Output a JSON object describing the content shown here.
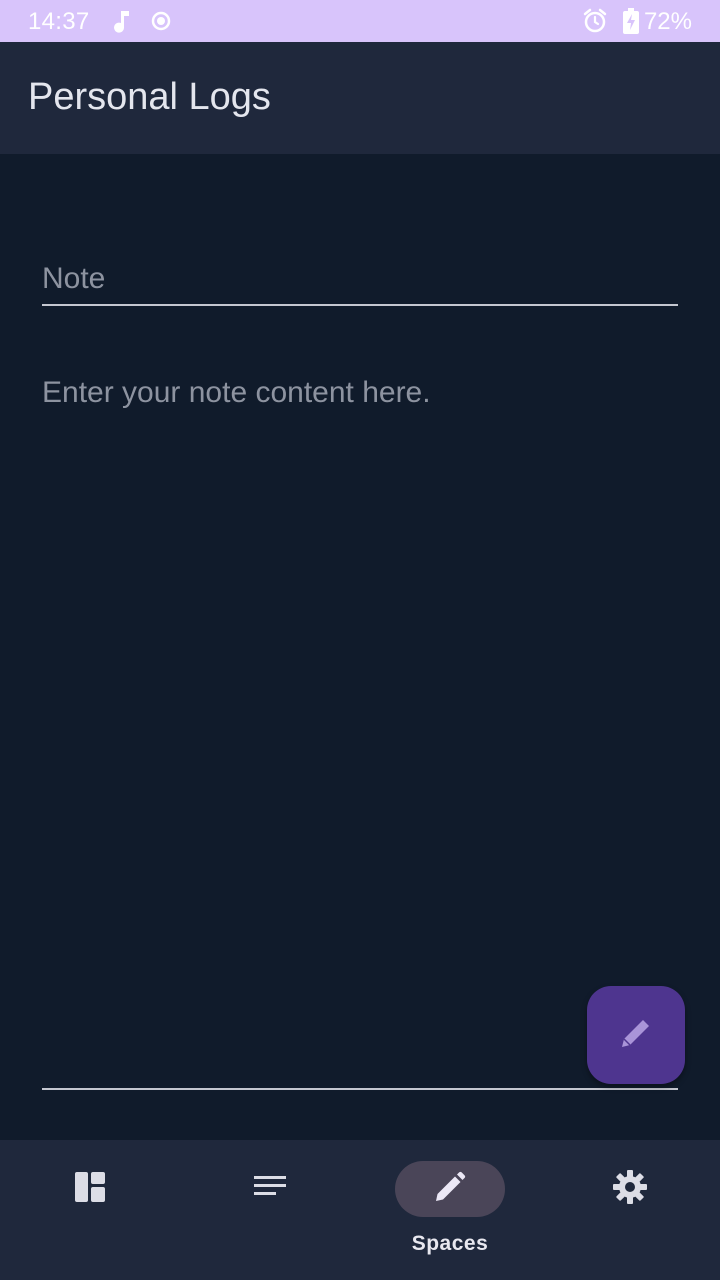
{
  "status_bar": {
    "time": "14:37",
    "battery_percent": "72%",
    "icons": [
      "music-note-icon",
      "record-icon",
      "alarm-icon",
      "battery-charging-icon"
    ]
  },
  "app_bar": {
    "title": "Personal Logs"
  },
  "editor": {
    "title_placeholder": "Note",
    "body_placeholder": "Enter your note content here."
  },
  "fab": {
    "icon": "pencil-icon"
  },
  "bottom_nav": {
    "items": [
      {
        "icon": "dashboard-icon",
        "label": ""
      },
      {
        "icon": "notes-list-icon",
        "label": ""
      },
      {
        "icon": "pencil-icon",
        "label": "Spaces",
        "active": true
      },
      {
        "icon": "settings-icon",
        "label": ""
      }
    ]
  },
  "colors": {
    "status_bar": "#d8c4fb",
    "app_bar": "#1f283c",
    "background": "#101b2b",
    "fab": "#4e358f",
    "active_nav_pill": "#4a4558"
  }
}
